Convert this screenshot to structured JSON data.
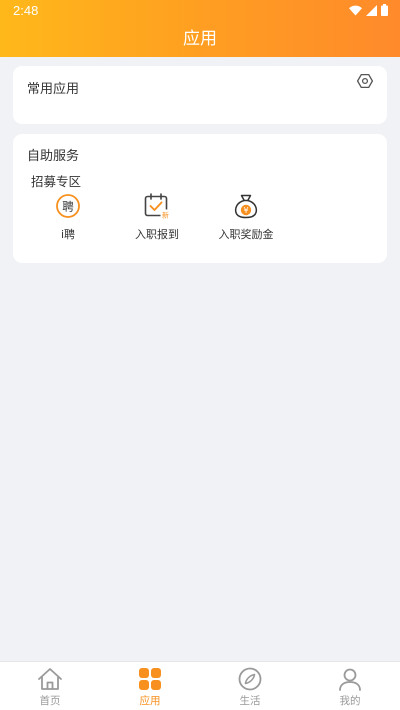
{
  "status_bar": {
    "time": "2:48"
  },
  "header": {
    "title": "应用"
  },
  "common_apps": {
    "title": "常用应用",
    "settings_icon": "settings-icon"
  },
  "self_service": {
    "title": "自助服务",
    "section": "招募专区",
    "items": [
      {
        "label": "i聘",
        "icon": "hire-icon",
        "badge": "聘"
      },
      {
        "label": "入职报到",
        "icon": "calendar-check-icon",
        "badge": "新"
      },
      {
        "label": "入职奖励金",
        "icon": "money-bag-icon",
        "badge": "¥"
      }
    ]
  },
  "tabbar": {
    "active": "应用",
    "accent_color": "#f7901e",
    "inactive_color": "#9a9a9a",
    "tabs": [
      {
        "label": "首页",
        "icon": "home-icon"
      },
      {
        "label": "应用",
        "icon": "apps-icon"
      },
      {
        "label": "生活",
        "icon": "compass-icon"
      },
      {
        "label": "我的",
        "icon": "profile-icon"
      }
    ]
  }
}
